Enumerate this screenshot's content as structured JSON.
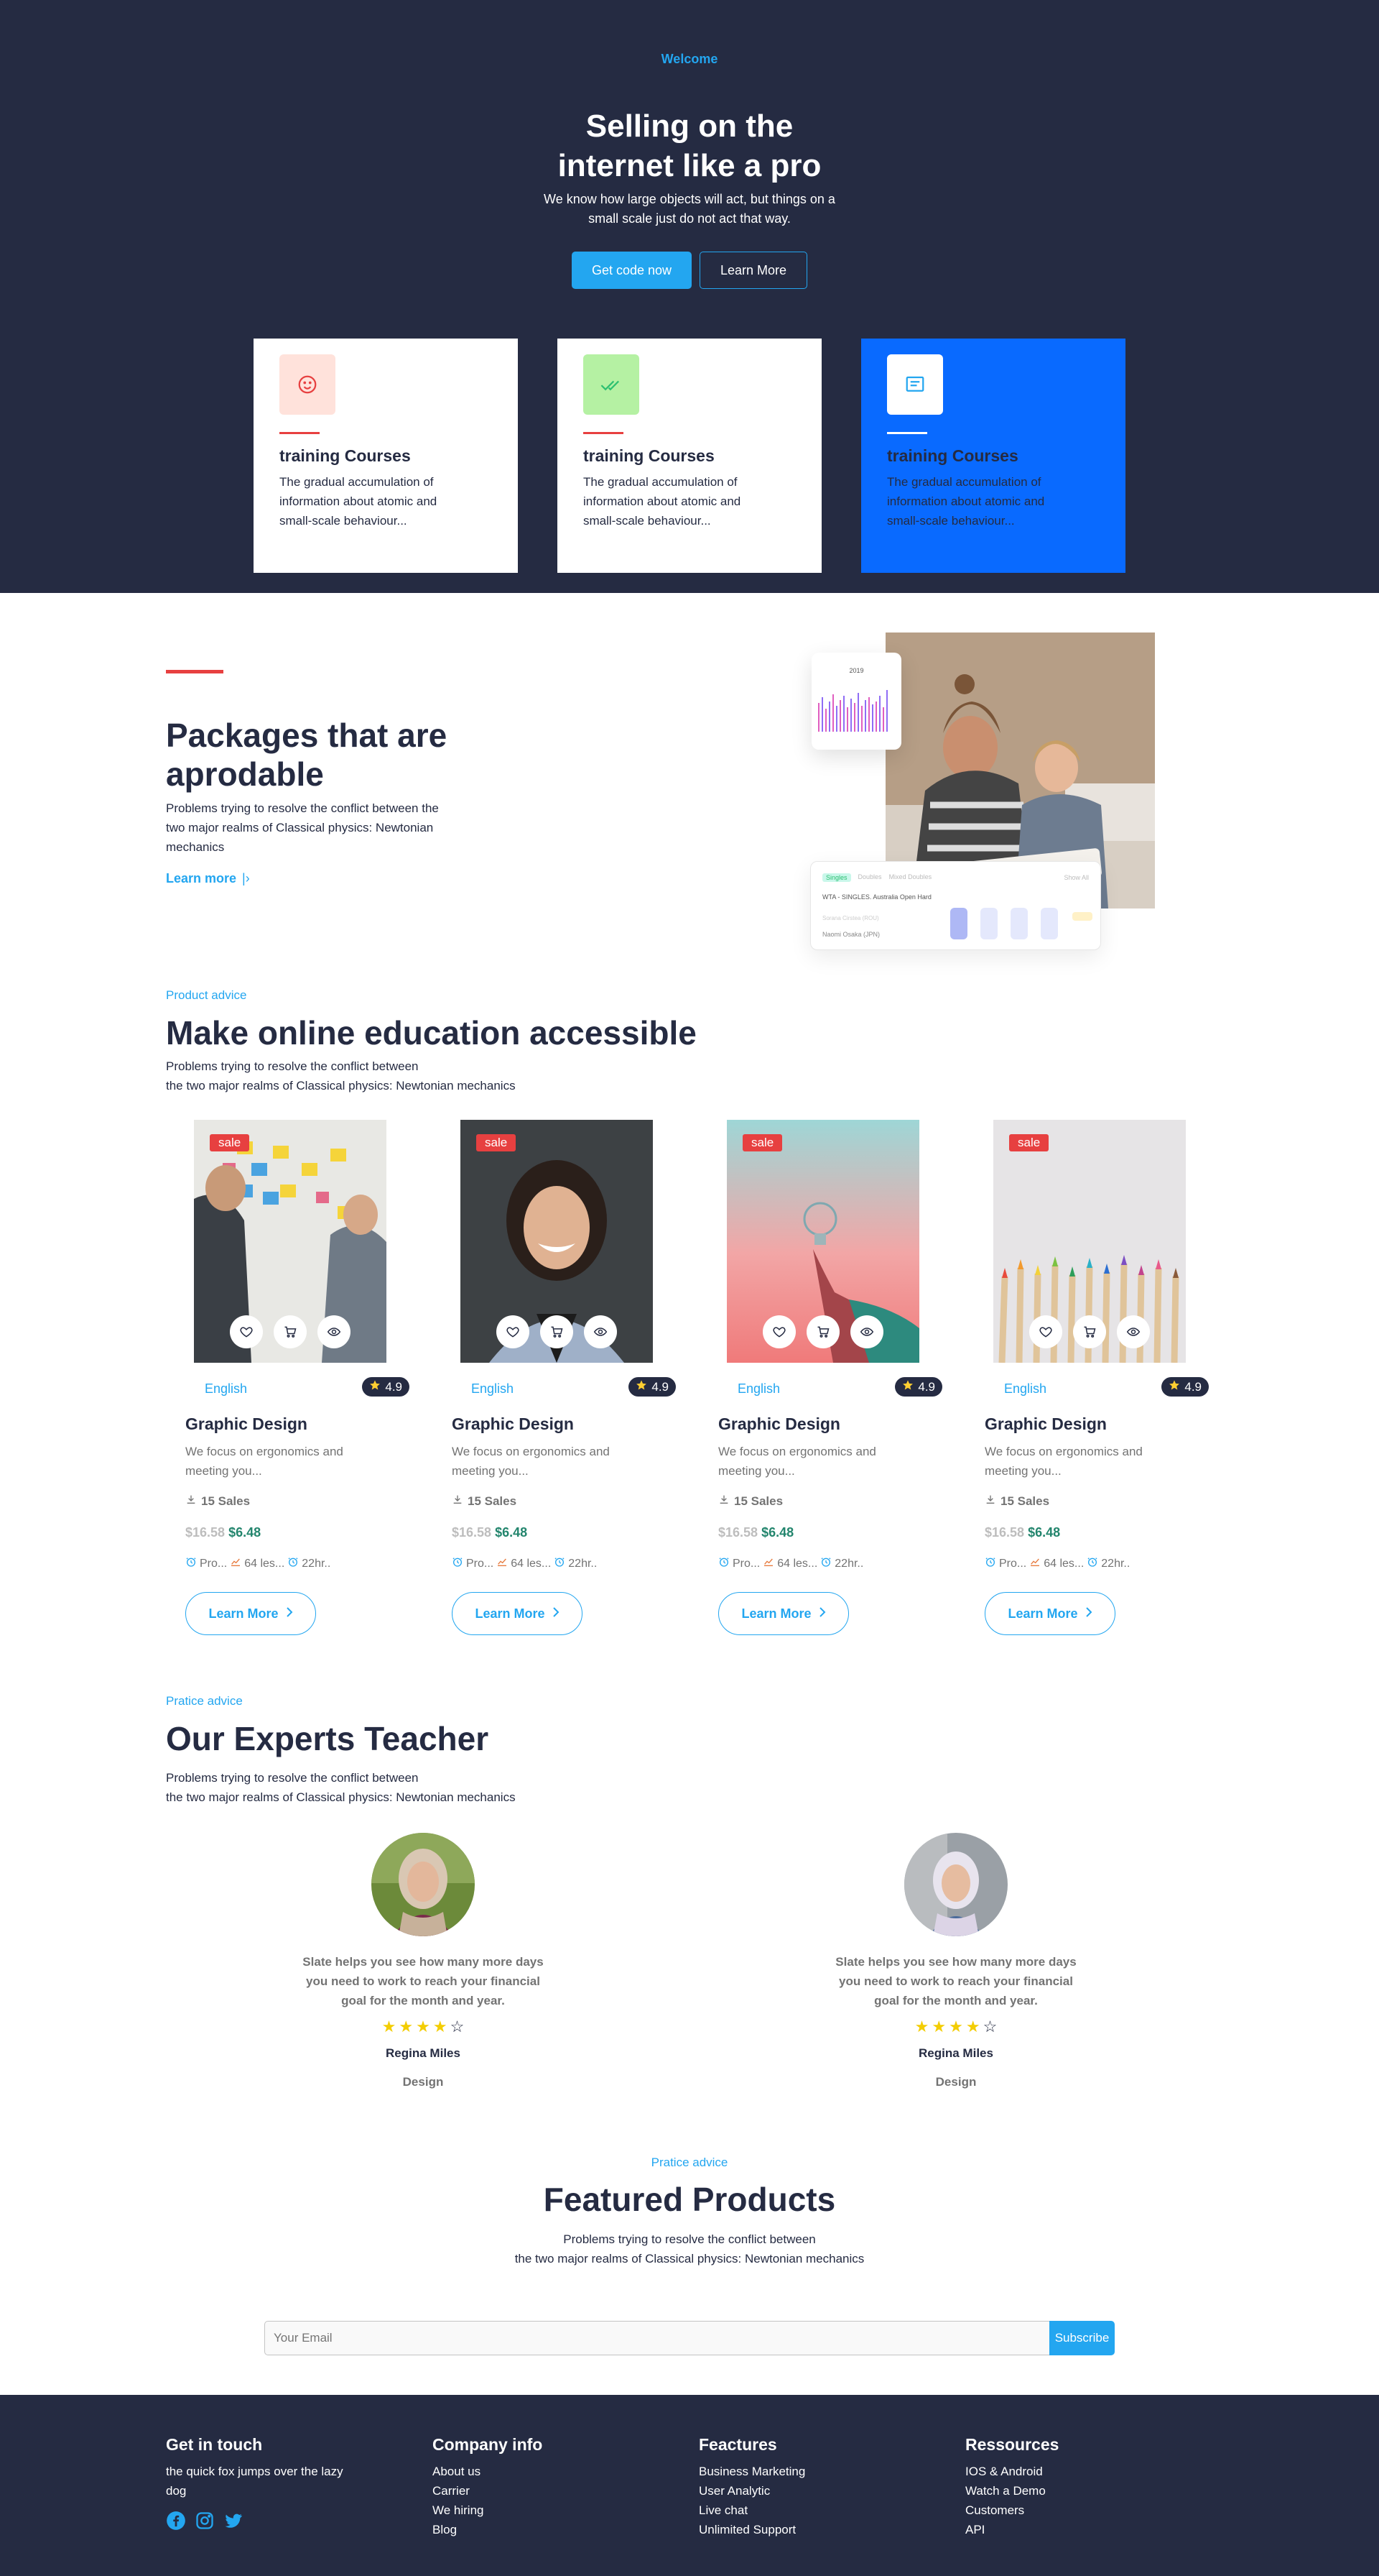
{
  "hero": {
    "eyebrow": "Welcome",
    "title_line1": "Selling on the",
    "title_line2": "internet like a pro",
    "subtitle_line1": "We know how large objects will act, but things on a",
    "subtitle_line2": "small scale just do not act that way.",
    "primary_button": "Get code now",
    "secondary_button": "Learn More"
  },
  "feature_cards": [
    {
      "title": "training Courses",
      "desc": "The gradual accumulation of information about atomic and small-scale behaviour...",
      "icon": "smile-icon"
    },
    {
      "title": "training Courses",
      "desc": "The gradual accumulation of information about atomic and small-scale behaviour...",
      "icon": "double-check-icon"
    },
    {
      "title": "training Courses",
      "desc": "The gradual accumulation of information about atomic and small-scale behaviour...",
      "icon": "document-icon"
    }
  ],
  "packages": {
    "title_line1": "Packages that are",
    "title_line2": "aprodable",
    "desc": "Problems trying to resolve the conflict between the two major realms of Classical physics: Newtonian mechanics",
    "link": "Learn more",
    "chart_year": "2019",
    "table_tab1": "Singles",
    "table_tab2": "Doubles",
    "table_tab3": "Mixed Doubles",
    "table_tab4": "Show All",
    "table_title": "WTA - SINGLES. Australia Open Hard",
    "table_row1": "Sorana Cirstea (ROU)",
    "table_row2": "Naomi Osaka (JPN)"
  },
  "courses": {
    "eyebrow": "Product advice",
    "title": "Make online education accessible",
    "desc_line1": "Problems trying to resolve the conflict between",
    "desc_line2": "the two major realms of Classical physics: Newtonian mechanics",
    "items": [
      {
        "sale": "sale",
        "category": "English",
        "rating": "4.9",
        "title": "Graphic Design",
        "desc": "We focus on ergonomics and meeting you...",
        "sales": "15 Sales",
        "old_price": "$16.58",
        "new_price": "$6.48",
        "meta1": "Pro...",
        "meta2": "64 les...",
        "meta3": "22hr..",
        "button": "Learn More"
      },
      {
        "sale": "sale",
        "category": "English",
        "rating": "4.9",
        "title": "Graphic Design",
        "desc": "We focus on ergonomics and meeting you...",
        "sales": "15 Sales",
        "old_price": "$16.58",
        "new_price": "$6.48",
        "meta1": "Pro...",
        "meta2": "64 les...",
        "meta3": "22hr..",
        "button": "Learn More"
      },
      {
        "sale": "sale",
        "category": "English",
        "rating": "4.9",
        "title": "Graphic Design",
        "desc": "We focus on ergonomics and meeting you...",
        "sales": "15 Sales",
        "old_price": "$16.58",
        "new_price": "$6.48",
        "meta1": "Pro...",
        "meta2": "64 les...",
        "meta3": "22hr..",
        "button": "Learn More"
      },
      {
        "sale": "sale",
        "category": "English",
        "rating": "4.9",
        "title": "Graphic Design",
        "desc": "We focus on ergonomics and meeting you...",
        "sales": "15 Sales",
        "old_price": "$16.58",
        "new_price": "$6.48",
        "meta1": "Pro...",
        "meta2": "64 les...",
        "meta3": "22hr..",
        "button": "Learn More"
      }
    ]
  },
  "teachers": {
    "eyebrow": "Pratice advice",
    "title": "Our Experts Teacher",
    "desc_line1": "Problems trying to resolve the conflict between",
    "desc_line2": "the two major realms of Classical physics: Newtonian mechanics",
    "items": [
      {
        "quote": "Slate helps you see how many more days you need to work to reach your financial goal for the month and year.",
        "stars": 4,
        "name": "Regina Miles",
        "role": "Design"
      },
      {
        "quote": "Slate helps you see how many more days you need to work to reach your financial goal for the month and year.",
        "stars": 4,
        "name": "Regina Miles",
        "role": "Design"
      }
    ]
  },
  "featured": {
    "eyebrow": "Pratice advice",
    "title": "Featured Products",
    "desc_line1": "Problems trying to resolve the conflict between",
    "desc_line2": "the two major realms of Classical physics: Newtonian mechanics",
    "email_placeholder": "Your Email",
    "subscribe": "Subscribe"
  },
  "footer": {
    "col1_title": "Get in touch",
    "col1_text": "the quick fox jumps over the lazy dog",
    "col2_title": "Company info",
    "col2_links": [
      "About us",
      "Carrier",
      "We hiring",
      "Blog"
    ],
    "col3_title": "Feactures",
    "col3_links": [
      "Business Marketing",
      "User Analytic",
      "Live chat",
      "Unlimited Support"
    ],
    "col4_title": "Ressources",
    "col4_links": [
      "IOS & Android",
      "Watch a Demo",
      "Customers",
      "API"
    ]
  },
  "colors": {
    "primary": "#23a6f0",
    "dark": "#252b42",
    "danger": "#e74040",
    "blue": "#096aff",
    "green": "#2dc071"
  }
}
